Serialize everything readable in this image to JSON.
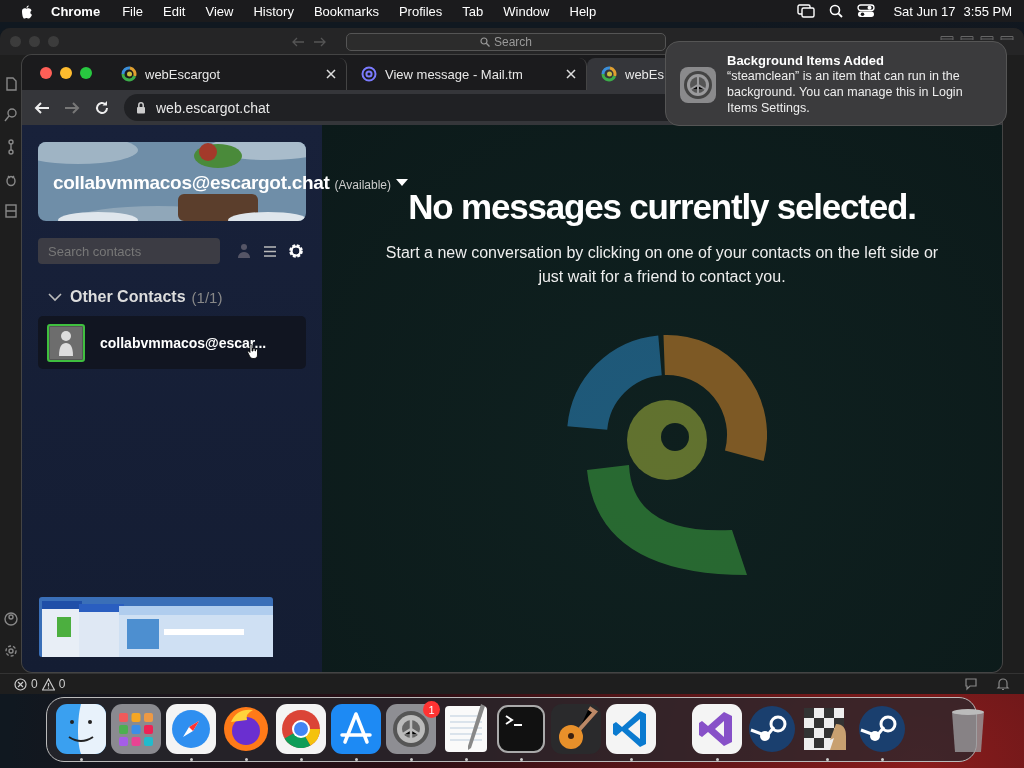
{
  "menubar": {
    "app": "Chrome",
    "menus": [
      "File",
      "Edit",
      "View",
      "History",
      "Bookmarks",
      "Profiles",
      "Tab",
      "Window",
      "Help"
    ],
    "date": "Sat Jun 17",
    "time": "3:55 PM"
  },
  "editor_window": {
    "search_placeholder": "Search",
    "status_bar": {
      "errors": "0",
      "warnings": "0"
    }
  },
  "browser": {
    "tabs": [
      {
        "title": "webEscargot",
        "selected": false
      },
      {
        "title": "View message - Mail.tm",
        "selected": false
      },
      {
        "title": "webEs",
        "selected": true
      }
    ],
    "address": "web.escargot.chat"
  },
  "sidebar": {
    "user": "collabvmmacos@escargot.chat",
    "status": "(Available)",
    "search": {
      "placeholder": "Search contacts"
    },
    "groups": [
      {
        "name": "Other Contacts",
        "count": "(1/1)",
        "expanded": true,
        "contacts": [
          {
            "name": "collabvmmacos@escar..."
          }
        ]
      }
    ]
  },
  "main": {
    "heading": "No messages currently selected.",
    "text": "Start a new conversation by clicking on one of your contacts on the left side or just wait for a friend to contact you."
  },
  "notification": {
    "title": "Background Items Added",
    "body": "“steamclean” is an item that can run in the background. You can manage this in Login Items Settings."
  },
  "dock": {
    "apps": [
      {
        "kind": "finder",
        "running": true
      },
      {
        "kind": "launchpad",
        "running": false
      },
      {
        "kind": "safari",
        "running": true
      },
      {
        "kind": "firefox",
        "running": true
      },
      {
        "kind": "chrome",
        "running": true
      },
      {
        "kind": "appstore",
        "running": true
      },
      {
        "kind": "settings",
        "running": true,
        "badge": "1"
      },
      {
        "kind": "textedit",
        "running": true
      },
      {
        "kind": "terminal",
        "running": true
      },
      {
        "kind": "guitar",
        "running": false
      },
      {
        "kind": "code",
        "running": true
      }
    ],
    "recent_apps": [
      {
        "kind": "studio",
        "running": true
      },
      {
        "kind": "steam",
        "running": false
      },
      {
        "kind": "chess",
        "running": true
      },
      {
        "kind": "steam",
        "running": true
      }
    ],
    "others": [
      {
        "kind": "trash",
        "running": false
      }
    ]
  }
}
